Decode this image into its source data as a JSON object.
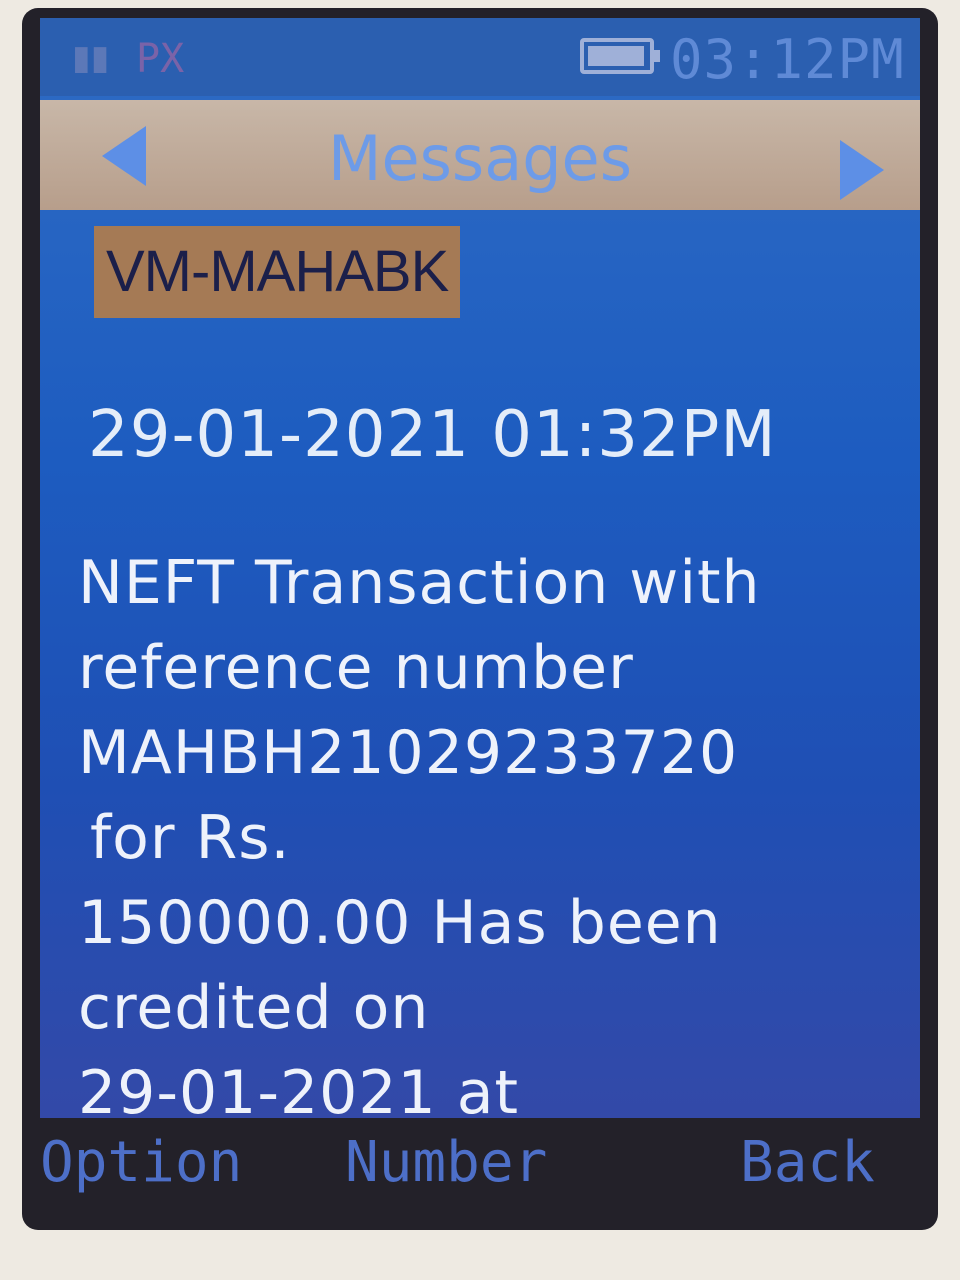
{
  "status_bar": {
    "signal_icon": "signal-bars-icon",
    "network": "PX",
    "battery_icon": "battery-icon",
    "time": "03:12PM"
  },
  "header": {
    "title": "Messages",
    "left_icon": "arrow-left-icon",
    "right_icon": "arrow-right-icon"
  },
  "message": {
    "sender": "VM-MAHABK",
    "timestamp": "29-01-2021 01:32PM",
    "body_lines": [
      "NEFT Transaction with",
      "reference number",
      "MAHBH21029233720",
      "for Rs.",
      "150000.00 Has been",
      "credited on",
      "29-01-2021 at"
    ]
  },
  "softkeys": {
    "left": "Option",
    "center": "Number",
    "right": "Back"
  }
}
